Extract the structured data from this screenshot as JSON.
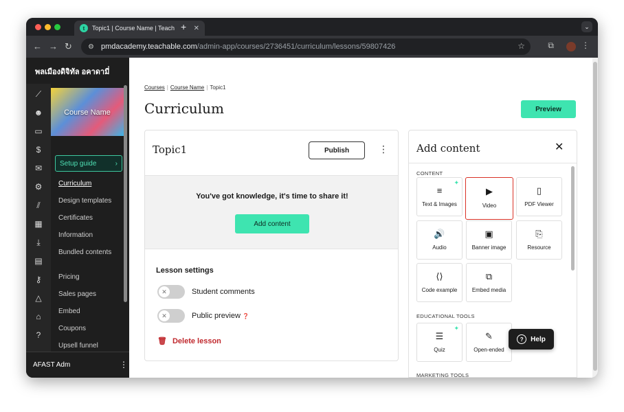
{
  "browser": {
    "tab_title": "Topic1 | Course Name | Teach",
    "tab_favicon": "t",
    "new_tab_icon": "+",
    "url_host": "pmdacademy.teachable.com",
    "url_path": "/admin-app/courses/2736451/curriculum/lessons/59807426"
  },
  "sidebar": {
    "school_name": "พลเมืองดิจิทัล อคาดามี่",
    "thumbnail_label": "Course Name",
    "setup_guide": "Setup guide",
    "links": [
      "Curriculum",
      "Design templates",
      "Certificates",
      "Information",
      "Bundled contents",
      "Pricing",
      "Sales pages",
      "Embed",
      "Coupons",
      "Upsell funnel"
    ],
    "rail_icons": [
      "trend-icon",
      "users-icon",
      "devices-icon",
      "dollar-icon",
      "mail-icon",
      "gear-icon",
      "library-icon",
      "calendar-icon",
      "download-icon",
      "chat-icon",
      "key-icon",
      "shapes-icon",
      "graduation-icon",
      "help-circle-icon"
    ],
    "admin_name": "AFAST Adm"
  },
  "main": {
    "breadcrumbs": [
      "Courses",
      "Course Name",
      "Topic1"
    ],
    "page_title": "Curriculum",
    "preview_label": "Preview"
  },
  "lesson": {
    "title": "Topic1",
    "publish_label": "Publish",
    "empty_message": "You've got knowledge, it's time to share it!",
    "add_content_label": "Add content",
    "settings_title": "Lesson settings",
    "student_comments": "Student comments",
    "public_preview": "Public preview",
    "delete_label": "Delete lesson"
  },
  "panel": {
    "title": "Add content",
    "section_content": "CONTENT",
    "section_educational": "EDUCATIONAL TOOLS",
    "section_marketing": "MARKETING TOOLS",
    "tiles": {
      "text_images": "Text & Images",
      "video": "Video",
      "pdf": "PDF Viewer",
      "audio": "Audio",
      "banner": "Banner image",
      "resource": "Resource",
      "code": "Code example",
      "embed": "Embed media",
      "quiz": "Quiz",
      "open_ended": "Open-ended"
    }
  },
  "help_label": "Help",
  "colors": {
    "accent": "#3ee4b0",
    "danger": "#c0282d",
    "highlight": "#d93025"
  }
}
